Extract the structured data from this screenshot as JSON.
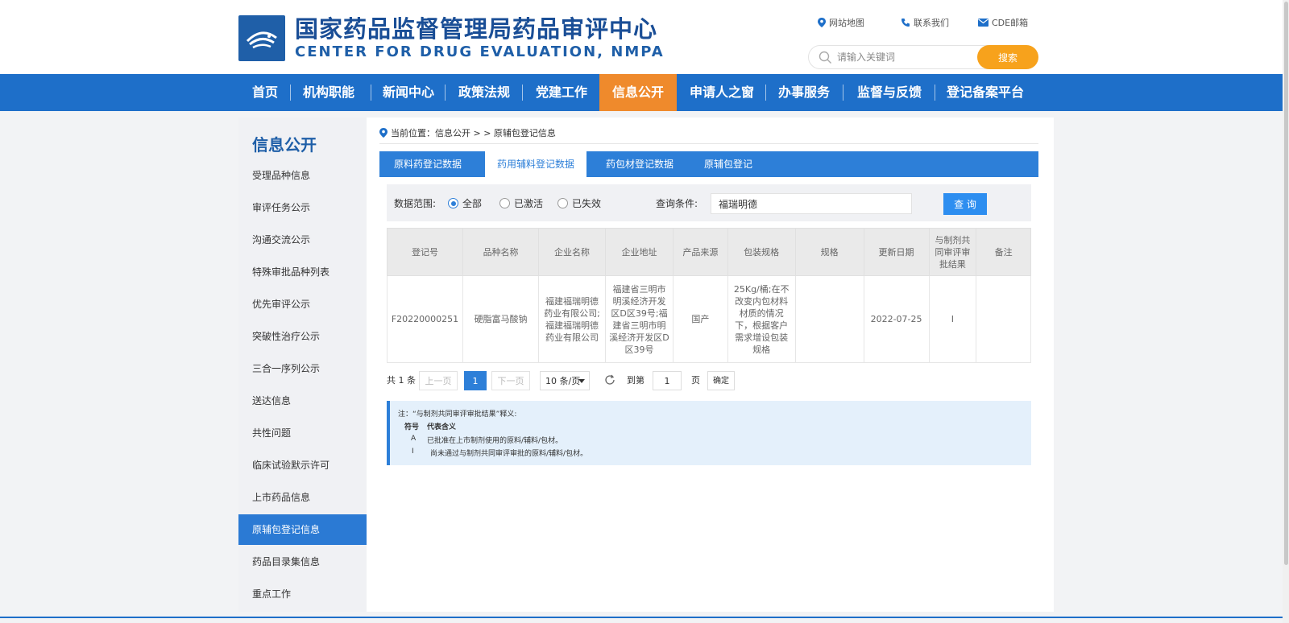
{
  "header": {
    "title_cn": "国家药品监督管理局药品审评中心",
    "title_en": "CENTER FOR DRUG EVALUATION, NMPA",
    "links": {
      "sitemap": "网站地图",
      "contact": "联系我们",
      "mail": "CDE邮箱"
    },
    "search": {
      "placeholder": "请输入关键词",
      "button": "搜索"
    }
  },
  "nav": {
    "items": [
      "首页",
      "机构职能",
      "新闻中心",
      "政策法规",
      "党建工作",
      "信息公开",
      "申请人之窗",
      "办事服务",
      "监督与反馈",
      "登记备案平台"
    ],
    "active": "信息公开"
  },
  "sidebar": {
    "title": "信息公开",
    "items": [
      "受理品种信息",
      "审评任务公示",
      "沟通交流公示",
      "特殊审批品种列表",
      "优先审评公示",
      "突破性治疗公示",
      "三合一序列公示",
      "送达信息",
      "共性问题",
      "临床试验默示许可",
      "上市药品信息",
      "原辅包登记信息",
      "药品目录集信息",
      "重点工作"
    ],
    "active": "原辅包登记信息"
  },
  "breadcrumb": {
    "text": "当前位置：信息公开 > > 原辅包登记信息"
  },
  "tabs": {
    "items": [
      "原料药登记数据",
      "药用辅料登记数据",
      "药包材登记数据",
      "原辅包登记"
    ],
    "active": "药用辅料登记数据"
  },
  "filter": {
    "scope_label": "数据范围:",
    "options": [
      "全部",
      "已激活",
      "已失效"
    ],
    "selected": "全部",
    "query_label": "查询条件:",
    "query_value": "福瑞明德",
    "query_button": "查 询"
  },
  "table": {
    "headers": [
      "登记号",
      "品种名称",
      "企业名称",
      "企业地址",
      "产品来源",
      "包装规格",
      "规格",
      "更新日期",
      "与制剂共同审评审批结果",
      "备注"
    ],
    "rows": [
      [
        "F20220000251",
        "硬脂富马酸钠",
        "福建福瑞明德药业有限公司;福建福瑞明德药业有限公司",
        "福建省三明市明溪经济开发区D区39号;福建省三明市明溪经济开发区D区39号",
        "国产",
        "25Kg/桶;在不改变内包材料材质的情况下，根据客户需求增设包装规格",
        "",
        "2022-07-25",
        "I",
        ""
      ]
    ]
  },
  "pager": {
    "total": "共 1 条",
    "prev": "上一页",
    "current": "1",
    "next": "下一页",
    "page_size": "10 条/页",
    "goto_label": "到第",
    "goto_value": "1",
    "page_unit": "页",
    "confirm": "确定"
  },
  "note": {
    "title": "注：“与制剂共同审评审批结果”释义:",
    "header_symbol": "符号",
    "header_meaning": "代表含义",
    "rows": [
      {
        "symbol": "A",
        "meaning": "已批准在上市制剂使用的原料/辅料/包材。"
      },
      {
        "symbol": "I",
        "meaning": "尚未通过与制剂共同审评审批的原料/辅料/包材。"
      }
    ]
  },
  "colors": {
    "nav_blue": "#1e6fc9",
    "nav_active_orange": "#ef8a2c",
    "search_orange": "#f7a21c",
    "tab_blue": "#2d7fd8",
    "sidebar_active": "#2b7ad4"
  }
}
